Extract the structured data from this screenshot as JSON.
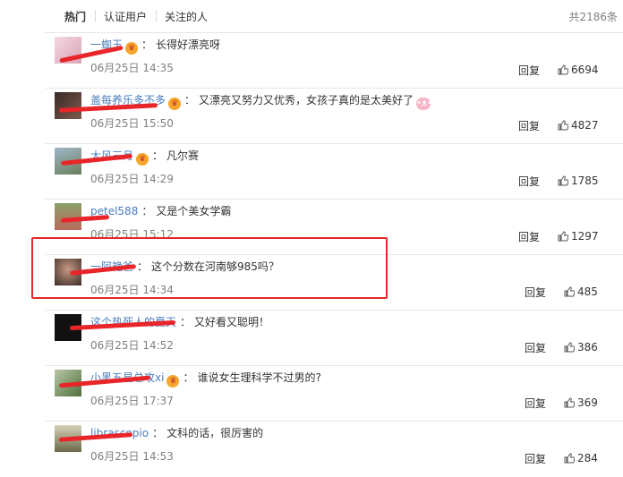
{
  "tabs": [
    {
      "label": "热门",
      "active": true
    },
    {
      "label": "认证用户",
      "active": false
    },
    {
      "label": "关注的人",
      "active": false
    }
  ],
  "total": "共2186条",
  "comments": [
    {
      "user": "一蜘王",
      "vip": true,
      "text": "长得好漂亮呀",
      "emoji": false,
      "time": "06月25日 14:35",
      "reply": "回复",
      "likes": "6694"
    },
    {
      "user": "盖每养乐多不多",
      "vip": true,
      "text": "又漂亮又努力又优秀，女孩子真的是太美好了",
      "emoji": true,
      "time": "06月25日 15:50",
      "reply": "回复",
      "likes": "4827"
    },
    {
      "user": "大风三月",
      "vip": true,
      "text": "凡尔赛",
      "emoji": false,
      "time": "06月25日 14:29",
      "reply": "回复",
      "likes": "1785"
    },
    {
      "user": "petel588",
      "vip": false,
      "text": "又是个美女学霸",
      "emoji": false,
      "time": "06月25日 15:12",
      "reply": "回复",
      "likes": "1297"
    },
    {
      "user": "一阿艳爸",
      "vip": false,
      "text": "这个分数在河南够985吗？",
      "emoji": false,
      "time": "06月25日 14:34",
      "reply": "回复",
      "likes": "485"
    },
    {
      "user": "这个热死人的夏天",
      "vip": false,
      "text": "又好看又聪明！",
      "emoji": false,
      "time": "06月25日 14:52",
      "reply": "回复",
      "likes": "386"
    },
    {
      "user": "小黑五星总攻xi",
      "vip": true,
      "text": "谁说女生理科学不过男的?",
      "emoji": false,
      "time": "06月25日 17:37",
      "reply": "回复",
      "likes": "369"
    },
    {
      "user": "librascopio",
      "vip": false,
      "text": "文科的话，很厉害的",
      "emoji": false,
      "time": "06月25日 14:53",
      "reply": "回复",
      "likes": "284"
    }
  ],
  "icons": {
    "vip": "crown-icon",
    "like": "thumbs-up-icon",
    "emoji": "pig-emoji-icon"
  },
  "colors": {
    "link": "#4a7dbf",
    "annotation": "#e8262a",
    "muted": "#808080"
  }
}
